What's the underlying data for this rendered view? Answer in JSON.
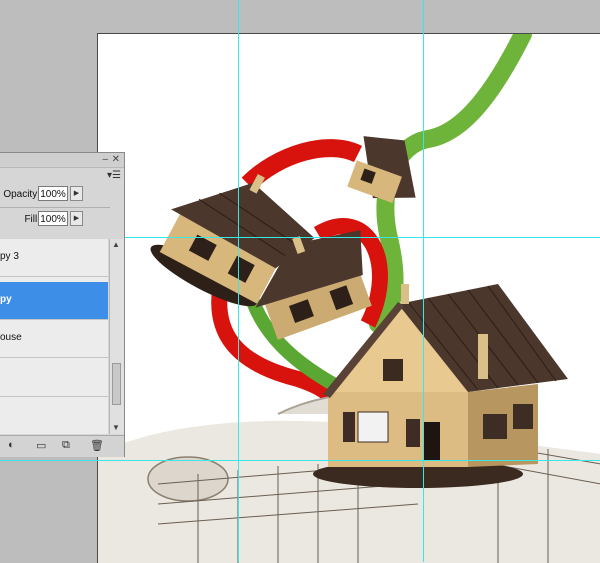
{
  "panel": {
    "opacity_label": "Opacity:",
    "opacity_value": "100%",
    "fill_label": "Fill:",
    "fill_value": "100%",
    "layers": [
      {
        "name": "py 3",
        "selected": false
      },
      {
        "name": "py",
        "selected": true
      },
      {
        "name": "ouse",
        "selected": false
      }
    ]
  },
  "icons": {
    "minimize": "minimize-icon",
    "close": "close-icon",
    "panel_menu": "panel-menu-icon",
    "adjustment": "adjustment-layer-icon",
    "group": "folder-icon",
    "new_layer": "new-layer-icon",
    "delete": "trash-icon"
  },
  "colors": {
    "selection": "#3d8ee6",
    "guide": "#38e8e8",
    "pipe_red": "#d8120c",
    "pipe_green": "#6fb43a"
  }
}
